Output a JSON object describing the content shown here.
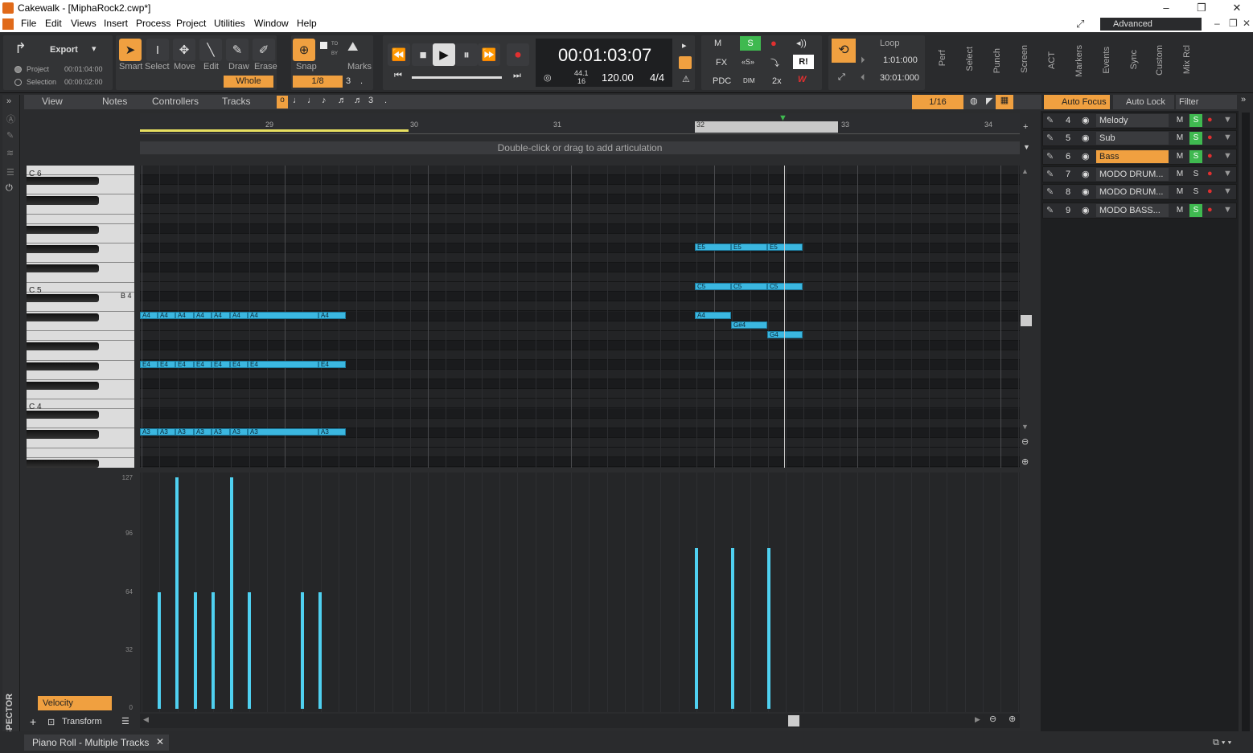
{
  "window": {
    "title": "Cakewalk - [MiphaRock2.cwp*]"
  },
  "menu": [
    "File",
    "Edit",
    "Views",
    "Insert",
    "Process",
    "Project",
    "Utilities",
    "Window",
    "Help"
  ],
  "workspace": "Advanced",
  "export": {
    "label": "Export",
    "project_label": "Project",
    "project_time": "00:01:04:00",
    "selection_label": "Selection",
    "selection_time": "00:00:02:00"
  },
  "tools": [
    "Smart",
    "Select",
    "Move",
    "Edit",
    "Draw",
    "Erase"
  ],
  "whole_label": "Whole",
  "snap": {
    "label": "Snap",
    "value": "1/8",
    "triplet": "3",
    "marks_label": "Marks",
    "to_label": "TO",
    "by_label": "BY"
  },
  "transport": {
    "time": "00:01:03:07",
    "sample_rate": "44.1",
    "bit_depth": "16",
    "tempo": "120.00",
    "meter": "4/4"
  },
  "mix_buttons": {
    "m": "M",
    "s": "S",
    "fx": "FX",
    "pdc": "PDC",
    "dim": "DIM",
    "x2": "2x",
    "ri": "R!"
  },
  "loop": {
    "label": "Loop",
    "start": "1:01:000",
    "end": "30:01:000"
  },
  "module_tabs": [
    "Perf",
    "Select",
    "Punch",
    "Screen",
    "ACT",
    "Markers",
    "Events",
    "Sync",
    "Custom",
    "Mix Rcl"
  ],
  "pr_menu": {
    "view": "View",
    "notes": "Notes",
    "controllers": "Controllers",
    "tracks": "Tracks"
  },
  "pr_snap": "1/16",
  "focus": {
    "auto_focus": "Auto Focus",
    "auto_lock": "Auto Lock",
    "filter": "Filter"
  },
  "ruler": [
    "29",
    "30",
    "31",
    "32",
    "33",
    "34"
  ],
  "articulation_hint": "Double-click or drag to add articulation",
  "keys": {
    "c6": "C 6",
    "c5": "C 5",
    "b4": "B 4",
    "c4": "C 4"
  },
  "velocity_scale": [
    "127",
    "96",
    "64",
    "32",
    "0"
  ],
  "velocity_label": "Velocity",
  "transform_label": "Transform",
  "inspector_label": "INSPECTOR",
  "bottom_tab": "Piano Roll - Multiple Tracks",
  "tracks": [
    {
      "num": "4",
      "name": "Melody",
      "m": "M",
      "s": "S",
      "selected": false,
      "solo": true
    },
    {
      "num": "5",
      "name": "Sub",
      "m": "M",
      "s": "S",
      "selected": false,
      "solo": true
    },
    {
      "num": "6",
      "name": "Bass",
      "m": "M",
      "s": "S",
      "selected": true,
      "solo": true
    },
    {
      "num": "7",
      "name": "MODO DRUM...",
      "m": "M",
      "s": "S",
      "selected": false,
      "solo": false
    },
    {
      "num": "8",
      "name": "MODO DRUM...",
      "m": "M",
      "s": "S",
      "selected": false,
      "solo": false
    },
    {
      "num": "9",
      "name": "MODO BASS...",
      "m": "M",
      "s": "S",
      "selected": false,
      "solo": true
    }
  ],
  "notes": {
    "a4": [
      "A4",
      "A4",
      "A4",
      "A4",
      "A4",
      "A4",
      "A4",
      "A4"
    ],
    "e4": [
      "E4",
      "E4",
      "E4",
      "E4",
      "E4",
      "E4",
      "E4",
      "E4"
    ],
    "a3": [
      "A3",
      "A3",
      "A3",
      "A3",
      "A3",
      "A3",
      "A3",
      "A3"
    ],
    "e5": [
      "E5",
      "E5",
      "E5"
    ],
    "c5": [
      "C5",
      "C5",
      "C5"
    ],
    "right_a4": "A4",
    "gs4": "G#4",
    "g4": "G4"
  },
  "velocities": [
    64,
    127,
    64,
    64,
    127,
    64,
    64,
    64,
    88,
    88,
    88
  ],
  "colors": {
    "accent": "#f0a040",
    "note": "#3bb7e0",
    "solo": "#3fb950",
    "record": "#e03030"
  }
}
